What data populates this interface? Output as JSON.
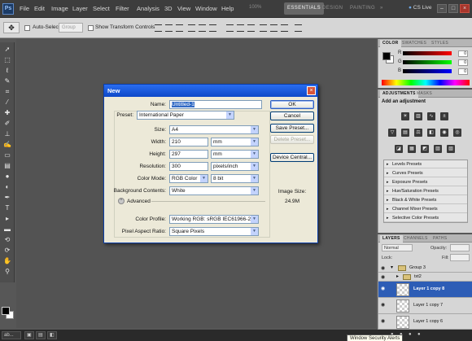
{
  "menu": {
    "logo": "Ps",
    "items": [
      "File",
      "Edit",
      "Image",
      "Layer",
      "Select",
      "Filter",
      "Analysis",
      "3D",
      "View",
      "Window",
      "Help"
    ],
    "zoom": "100%",
    "workspaces": [
      "ESSENTIALS",
      "DESIGN",
      "PAINTING",
      "»"
    ],
    "cs_live": "CS Live"
  },
  "options_bar": {
    "auto_select_label": "Auto-Select:",
    "auto_select_value": "Group",
    "transform_label": "Show Transform Controls"
  },
  "color_panel": {
    "tabs": [
      "COLOR",
      "SWATCHES",
      "STYLES"
    ],
    "channels": [
      {
        "label": "R",
        "value": "0",
        "color_from": "#000000",
        "color_to": "#ff0000"
      },
      {
        "label": "G",
        "value": "0",
        "color_from": "#000000",
        "color_to": "#00ff00"
      },
      {
        "label": "B",
        "value": "0",
        "color_from": "#000000",
        "color_to": "#0000ff"
      }
    ]
  },
  "adjustments_panel": {
    "tabs": [
      "ADJUSTMENTS",
      "MASKS"
    ],
    "title": "Add an adjustment",
    "presets": [
      "Levels Presets",
      "Curves Presets",
      "Exposure Presets",
      "Hue/Saturation Presets",
      "Black & White Presets",
      "Channel Mixer Presets",
      "Selective Color Presets"
    ]
  },
  "layers_panel": {
    "tabs": [
      "LAYERS",
      "CHANNELS",
      "PATHS"
    ],
    "blend_mode": "Normal",
    "opacity_label": "Opacity:",
    "fill_label": "Fill:",
    "lock_label": "Lock:",
    "layers": [
      {
        "name": "Group 3",
        "type": "group"
      },
      {
        "name": "txt2",
        "type": "group"
      },
      {
        "name": "Layer 1 copy 8",
        "type": "layer",
        "selected": true
      },
      {
        "name": "Layer 1 copy 7",
        "type": "layer",
        "selected": false
      },
      {
        "name": "Layer 1 copy 6",
        "type": "layer",
        "selected": false
      }
    ]
  },
  "dialog": {
    "title": "New",
    "name_label": "Name:",
    "name_value": "Untitled-1",
    "preset_label": "Preset:",
    "preset_value": "International Paper",
    "size_label": "Size:",
    "size_value": "A4",
    "width_label": "Width:",
    "width_value": "210",
    "width_unit": "mm",
    "height_label": "Height:",
    "height_value": "297",
    "height_unit": "mm",
    "resolution_label": "Resolution:",
    "resolution_value": "300",
    "resolution_unit": "pixels/inch",
    "color_mode_label": "Color Mode:",
    "color_mode_value": "RGB Color",
    "bit_depth_value": "8 bit",
    "bg_contents_label": "Background Contents:",
    "bg_contents_value": "White",
    "advanced_label": "Advanced",
    "color_profile_label": "Color Profile:",
    "color_profile_value": "Working RGB: sRGB IEC61966-2.1",
    "pixel_aspect_label": "Pixel Aspect Ratio:",
    "pixel_aspect_value": "Square Pixels",
    "buttons": {
      "ok": "OK",
      "cancel": "Cancel",
      "save_preset": "Save Preset...",
      "delete_preset": "Delete Preset...",
      "device_central": "Device Central..."
    },
    "image_size_label": "Image Size:",
    "image_size_value": "24.9M"
  },
  "taskbar": {
    "items": [
      "ab..."
    ],
    "tooltip": "Window Security Alerts"
  }
}
